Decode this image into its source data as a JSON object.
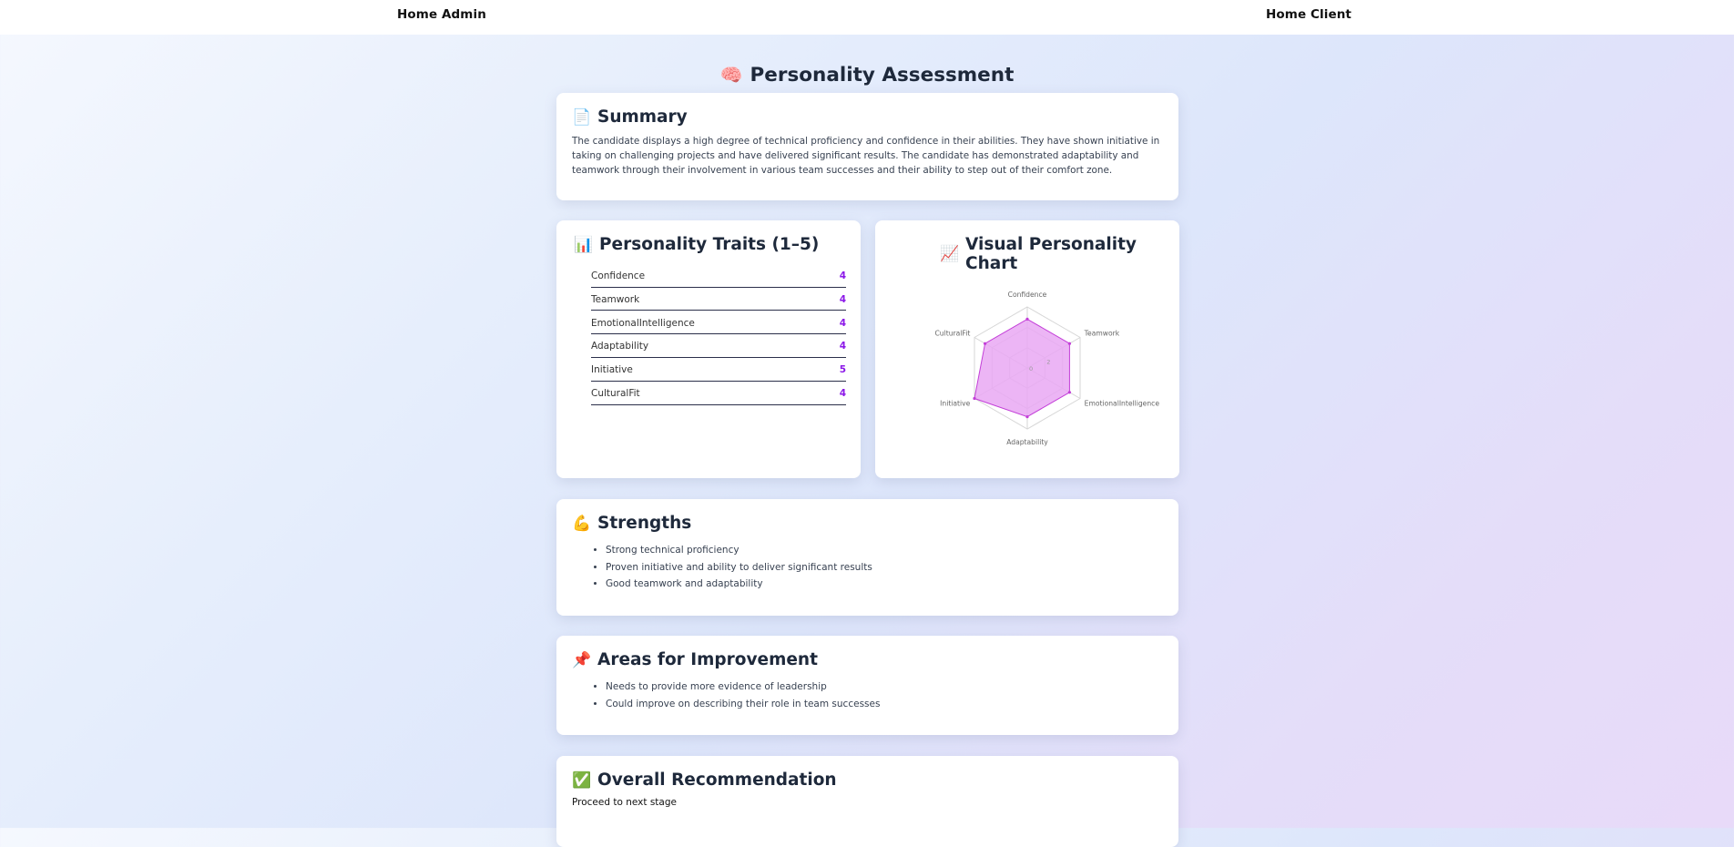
{
  "nav": {
    "admin": "Home Admin",
    "client": "Home Client"
  },
  "page_title": {
    "icon": "brain-icon",
    "emoji": "🧠",
    "text": "Personality Assessment"
  },
  "summary": {
    "icon": "page-icon",
    "emoji": "📄",
    "title": "Summary",
    "text": "The candidate displays a high degree of technical proficiency and confidence in their abilities. They have shown initiative in taking on challenging projects and have delivered significant results. The candidate has demonstrated adaptability and teamwork through their involvement in various team successes and their ability to step out of their comfort zone."
  },
  "traits": {
    "icon": "bar-chart-icon",
    "emoji": "📊",
    "title": "Personality Traits (1–5)",
    "items": [
      {
        "label": "Confidence",
        "value": "4"
      },
      {
        "label": "Teamwork",
        "value": "4"
      },
      {
        "label": "EmotionalIntelligence",
        "value": "4"
      },
      {
        "label": "Adaptability",
        "value": "4"
      },
      {
        "label": "Initiative",
        "value": "5"
      },
      {
        "label": "CulturalFit",
        "value": "4"
      }
    ]
  },
  "chart_card": {
    "icon": "line-chart-icon",
    "emoji": "📈",
    "title": "Visual Personality Chart"
  },
  "chart_data": {
    "type": "radar",
    "categories": [
      "Confidence",
      "Teamwork",
      "EmotionalIntelligence",
      "Adaptability",
      "Initiative",
      "CulturalFit"
    ],
    "values": [
      4,
      4,
      4,
      4,
      5,
      4
    ],
    "range": [
      0,
      5
    ],
    "rings": 3,
    "tick_labels": [
      "0",
      "2"
    ],
    "fill_color": "#e9a8f3",
    "stroke_color": "#c33fd8",
    "grid_color": "#d6d6d6",
    "label_color": "#666666"
  },
  "strengths": {
    "icon": "flexed-biceps-icon",
    "emoji": "💪",
    "title": "Strengths",
    "items": [
      "Strong technical proficiency",
      "Proven initiative and ability to deliver significant results",
      "Good teamwork and adaptability"
    ]
  },
  "improvement": {
    "icon": "pushpin-icon",
    "emoji": "📌",
    "title": "Areas for Improvement",
    "items": [
      "Needs to provide more evidence of leadership",
      "Could improve on describing their role in team successes"
    ]
  },
  "recommendation": {
    "icon": "check-mark-icon",
    "emoji": "✅",
    "title": "Overall Recommendation",
    "text": "Proceed to next stage"
  }
}
